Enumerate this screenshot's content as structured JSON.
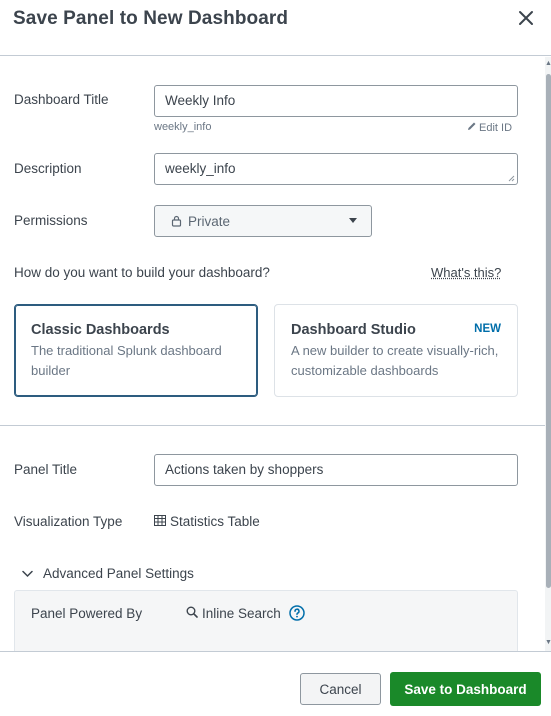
{
  "dialog": {
    "title": "Save Panel to New Dashboard"
  },
  "form": {
    "dashboard_title_label": "Dashboard Title",
    "dashboard_title_value": "Weekly Info",
    "dashboard_id": "weekly_info",
    "edit_id_label": "Edit ID",
    "description_label": "Description",
    "description_value": "weekly_info",
    "permissions_label": "Permissions",
    "permissions_value": "Private",
    "build_question": "How do you want to build your dashboard?",
    "whats_this_link": "What's this?"
  },
  "builder_options": [
    {
      "title": "Classic Dashboards",
      "description": "The traditional Splunk dashboard builder",
      "selected": true
    },
    {
      "title": "Dashboard Studio",
      "badge": "NEW",
      "description": "A new builder to create visually-rich, customizable dashboards",
      "selected": false
    }
  ],
  "panel": {
    "panel_title_label": "Panel Title",
    "panel_title_value": "Actions taken by shoppers",
    "viz_type_label": "Visualization Type",
    "viz_type_value": "Statistics Table",
    "advanced_toggle_label": "Advanced Panel Settings",
    "powered_by_label": "Panel Powered By",
    "powered_by_value": "Inline Search"
  },
  "footer": {
    "cancel_label": "Cancel",
    "save_label": "Save to Dashboard"
  },
  "colors": {
    "primary_button": "#1a8929",
    "selected_card_border": "#2d5c7f",
    "badge_new": "#006eaa",
    "help_icon": "#006eaa"
  },
  "icons": {
    "close": "close-icon",
    "edit": "pencil-icon",
    "lock": "lock-icon",
    "caret": "caret-down-icon",
    "table": "table-icon",
    "chevron": "chevron-down-icon",
    "search": "search-icon",
    "help": "help-circle-icon"
  }
}
